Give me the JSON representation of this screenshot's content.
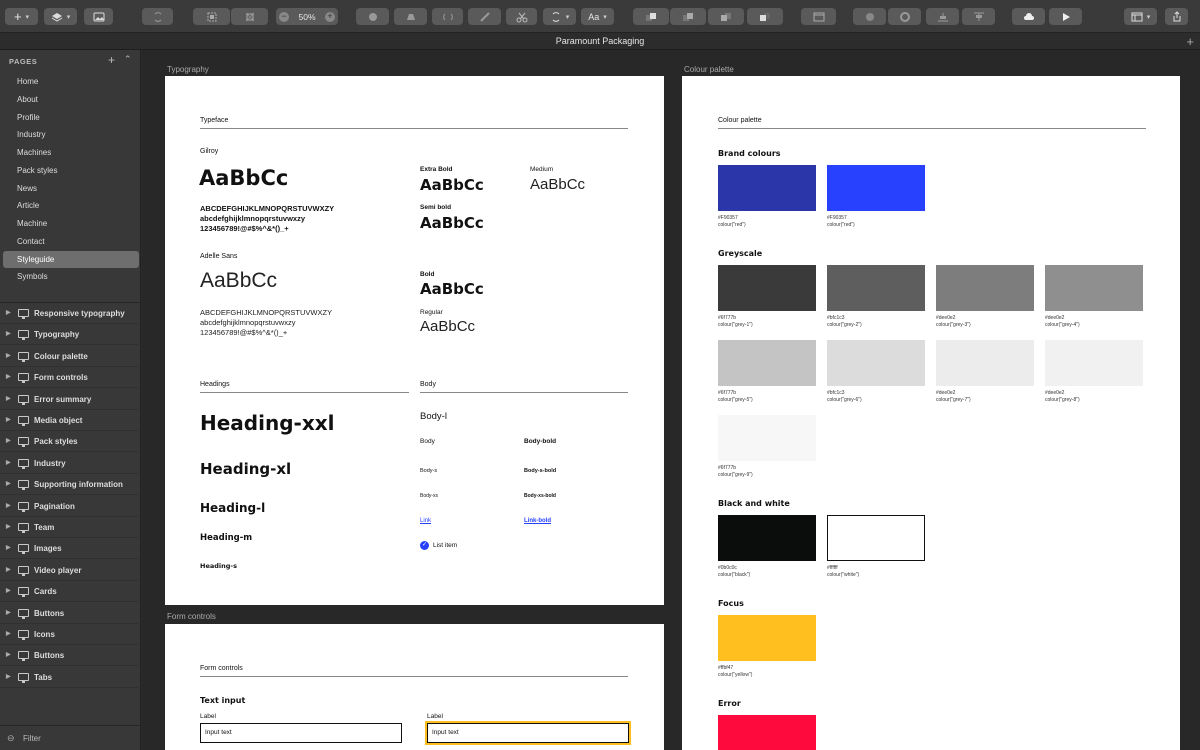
{
  "toolbar": {
    "zoom": "50%",
    "font_btn": "Aa"
  },
  "document": {
    "title": "Paramount Packaging"
  },
  "sidebar": {
    "pages_heading": "PAGES",
    "pages": [
      "Home",
      "About",
      "Profile",
      "Industry",
      "Machines",
      "Pack styles",
      "News",
      "Article",
      "Machine",
      "Contact",
      "Styleguide",
      "Symbols"
    ],
    "selected_page": "Styleguide",
    "layers": [
      "Responsive typography",
      "Typography",
      "Colour palette",
      "Form controls",
      "Error summary",
      "Media object",
      "Pack styles",
      "Industry",
      "Supporting information",
      "Pagination",
      "Team",
      "Images",
      "Video player",
      "Cards",
      "Buttons",
      "Icons",
      "Buttons",
      "Tabs"
    ],
    "filter": "Filter"
  },
  "artboards": {
    "typography": "Typography",
    "colour": "Colour palette",
    "form": "Form controls"
  },
  "typography": {
    "typeface_heading": "Typeface",
    "gilroy": "Gilroy",
    "sample": "AaBbCc",
    "gilroy_upper": "ABCDEFGHIJKLMNOPQRSTUVWXZY",
    "gilroy_lower": "abcdefghijklmnopqrstuvwxzy",
    "gilroy_nums": "123456789!@#$%^&*()_+",
    "extra_bold": "Extra Bold",
    "medium": "Medium",
    "semi_bold": "Semi bold",
    "adelle": "Adelle Sans",
    "adelle_upper": "ABCDEFGHIJKLMNOPQRSTUVWXZY",
    "adelle_lower": "abcdefghijklmnopqrstuvwxzy",
    "adelle_nums": "123456789!@#$%^&*()_+",
    "bold": "Bold",
    "regular": "Regular",
    "headings_heading": "Headings",
    "body_heading": "Body",
    "h_xxl": "Heading-xxl",
    "h_xl": "Heading-xl",
    "h_l": "Heading-l",
    "h_m": "Heading-m",
    "h_s": "Heading-s",
    "body_l": "Body-l",
    "body": "Body",
    "body_bold": "Body-bold",
    "body_s": "Body-s",
    "body_s_bold": "Body-s-bold",
    "body_xs": "Body-xs",
    "body_xs_bold": "Body-xs-bold",
    "link": "Link",
    "link_bold": "Link-bold",
    "list_item": "List item"
  },
  "colour": {
    "heading": "Colour palette",
    "brand": "Brand colours",
    "greyscale": "Greyscale",
    "bw": "Black and white",
    "focus": "Focus",
    "error": "Error",
    "brand_swatches": [
      {
        "color": "#2b37a8",
        "hex": "#F90357",
        "fn": "colour(\"red\")"
      },
      {
        "color": "#2741ff",
        "hex": "#F90357",
        "fn": "colour(\"red\")"
      }
    ],
    "grey_swatches": [
      {
        "color": "#3a3a3a",
        "hex": "#6f777b",
        "fn": "colour(\"grey-1\")"
      },
      {
        "color": "#5e5e5e",
        "hex": "#bfc1c3",
        "fn": "colour(\"grey-2\")"
      },
      {
        "color": "#7d7d7d",
        "hex": "#dee0e2",
        "fn": "colour(\"grey-3\")"
      },
      {
        "color": "#8f8f8f",
        "hex": "#dee0e2",
        "fn": "colour(\"grey-4\")"
      },
      {
        "color": "#c4c4c4",
        "hex": "#6f777b",
        "fn": "colour(\"grey-5\")"
      },
      {
        "color": "#dcdcdc",
        "hex": "#bfc1c3",
        "fn": "colour(\"grey-6\")"
      },
      {
        "color": "#ececec",
        "hex": "#dee0e2",
        "fn": "colour(\"grey-7\")"
      },
      {
        "color": "#f1f1f1",
        "hex": "#dee0e2",
        "fn": "colour(\"grey-8\")"
      },
      {
        "color": "#f7f7f7",
        "hex": "#6f777b",
        "fn": "colour(\"grey-9\")"
      }
    ],
    "bw_swatches": [
      {
        "color": "#0b0c0c",
        "hex": "#0b0c0c",
        "fn": "colour(\"black\")"
      },
      {
        "color": "#ffffff",
        "hex": "#ffffff",
        "fn": "colour(\"white\")"
      }
    ],
    "focus_swatch": {
      "color": "#ffbf1e",
      "hex": "#ffbf47",
      "fn": "colour(\"yellow\")"
    },
    "error_swatch": {
      "color": "#ff0a3c"
    }
  },
  "form": {
    "heading": "Form controls",
    "text_input": "Text input",
    "label1": "Label",
    "value1": "Input text",
    "label2": "Label",
    "value2": "Input text"
  }
}
